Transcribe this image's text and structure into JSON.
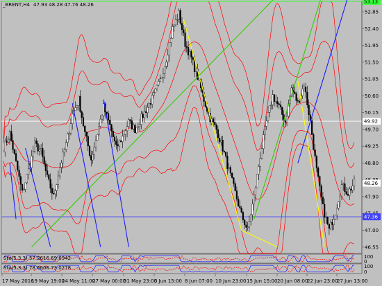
{
  "header": {
    "symbol": "_BRENT,H4",
    "ohlc": "47.93 48.28 47.76 48.26"
  },
  "indicators": {
    "stoch1": "Sto(5,3,3) 57.2616 69.6942",
    "stoch2": "Sto(5,3,3) 78.6006 73.0278"
  },
  "colors": {
    "background": "#c0c0c0",
    "candle_bull": "#ffffff",
    "candle_bear": "#000000",
    "bollinger": "#ff0000",
    "trend_green": "#33cc00",
    "trend_yellow": "#ffff00",
    "trend_blue": "#1a1aff",
    "hline_blue": "#3f3fff",
    "hline_white": "#ffffff",
    "hline_top": "#33ff33"
  },
  "chart_data": {
    "type": "candlestick",
    "symbol": "_BRENT",
    "timeframe": "H4",
    "price_ticks": [
      "52.85",
      "52.40",
      "51.95",
      "51.50",
      "51.05",
      "50.60",
      "50.15",
      "49.70",
      "49.25",
      "48.80",
      "48.35",
      "47.90",
      "47.45",
      "47.00",
      "46.55"
    ],
    "time_ticks": [
      "17 May 2016",
      "19 May 19:00",
      "24 May 11:00",
      "27 May 00:00",
      "31 May 23:00",
      "3 Jun 15:00",
      "8 Jun 07:00",
      "10 Jun 23:00",
      "15 Jun 15:00",
      "20 Jun 08:00",
      "22 Jun 23:00",
      "27 Jun 13:00"
    ],
    "ylim": [
      46.55,
      53.25
    ],
    "price_tags": [
      {
        "label": "53.13",
        "value": 53.13,
        "color": "#33ff33"
      },
      {
        "label": "49.92",
        "value": 49.92,
        "color": "#ffffff"
      },
      {
        "label": "48.26",
        "value": 48.26,
        "color": "#ffffff"
      },
      {
        "label": "47.36",
        "value": 47.36,
        "color": "#3f3fff"
      }
    ],
    "horizontal_lines": [
      {
        "value": 53.13,
        "color": "#33ff33"
      },
      {
        "value": 49.92,
        "color": "#ffffff"
      },
      {
        "value": 47.36,
        "color": "#3f3fff"
      }
    ],
    "close_path": [
      [
        0,
        49.2
      ],
      [
        4,
        49.6
      ],
      [
        8,
        48.8
      ],
      [
        12,
        48.0
      ],
      [
        16,
        48.6
      ],
      [
        20,
        49.3
      ],
      [
        24,
        49.1
      ],
      [
        28,
        48.4
      ],
      [
        32,
        47.9
      ],
      [
        36,
        48.7
      ],
      [
        40,
        49.3
      ],
      [
        44,
        50.1
      ],
      [
        48,
        50.5
      ],
      [
        52,
        49.6
      ],
      [
        56,
        48.9
      ],
      [
        60,
        49.6
      ],
      [
        64,
        50.3
      ],
      [
        68,
        49.8
      ],
      [
        72,
        49.2
      ],
      [
        76,
        49.5
      ],
      [
        80,
        49.9
      ],
      [
        84,
        49.7
      ],
      [
        88,
        50.0
      ],
      [
        92,
        50.3
      ],
      [
        96,
        50.6
      ],
      [
        100,
        51.0
      ],
      [
        104,
        51.6
      ],
      [
        108,
        52.4
      ],
      [
        112,
        52.8
      ],
      [
        116,
        52.0
      ],
      [
        120,
        51.6
      ],
      [
        124,
        51.1
      ],
      [
        128,
        50.5
      ],
      [
        132,
        50.0
      ],
      [
        136,
        49.7
      ],
      [
        140,
        49.2
      ],
      [
        144,
        48.6
      ],
      [
        148,
        48.0
      ],
      [
        152,
        47.4
      ],
      [
        156,
        47.0
      ],
      [
        160,
        47.9
      ],
      [
        164,
        49.0
      ],
      [
        168,
        49.9
      ],
      [
        172,
        50.6
      ],
      [
        176,
        50.3
      ],
      [
        180,
        49.9
      ],
      [
        184,
        50.8
      ],
      [
        188,
        50.4
      ],
      [
        192,
        50.9
      ],
      [
        196,
        49.9
      ],
      [
        200,
        48.6
      ],
      [
        204,
        47.6
      ],
      [
        208,
        47.0
      ],
      [
        212,
        47.5
      ],
      [
        216,
        48.2
      ],
      [
        220,
        48.0
      ],
      [
        224,
        48.26
      ]
    ],
    "trend_lines": [
      {
        "color": "#33cc00",
        "from": [
          18,
          46.55
        ],
        "to": [
          174,
          53.25
        ]
      },
      {
        "color": "#33cc00",
        "from": [
          160,
          47.3
        ],
        "to": [
          203,
          53.25
        ]
      },
      {
        "color": "#33ff33",
        "from": [
          0,
          53.13
        ],
        "to": [
          224,
          53.13
        ]
      },
      {
        "color": "#ffff00",
        "from": [
          115,
          52.65
        ],
        "to": [
          152,
          47.0
        ]
      },
      {
        "color": "#ffff00",
        "from": [
          152,
          47.0
        ],
        "to": [
          175,
          46.55
        ]
      },
      {
        "color": "#ffff00",
        "from": [
          188,
          51.0
        ],
        "to": [
          205,
          46.55
        ]
      },
      {
        "color": "#1a1aff",
        "from": [
          188,
          48.8
        ],
        "to": [
          220,
          53.25
        ]
      },
      {
        "color": "#1a1aff",
        "from": [
          4,
          48.8
        ],
        "to": [
          8,
          47.3
        ]
      },
      {
        "color": "#1a1aff",
        "from": [
          14,
          49.2
        ],
        "to": [
          30,
          46.55
        ]
      },
      {
        "color": "#1a1aff",
        "from": [
          44,
          50.4
        ],
        "to": [
          62,
          46.55
        ]
      },
      {
        "color": "#1a1aff",
        "from": [
          64,
          50.5
        ],
        "to": [
          80,
          46.55
        ]
      }
    ]
  }
}
